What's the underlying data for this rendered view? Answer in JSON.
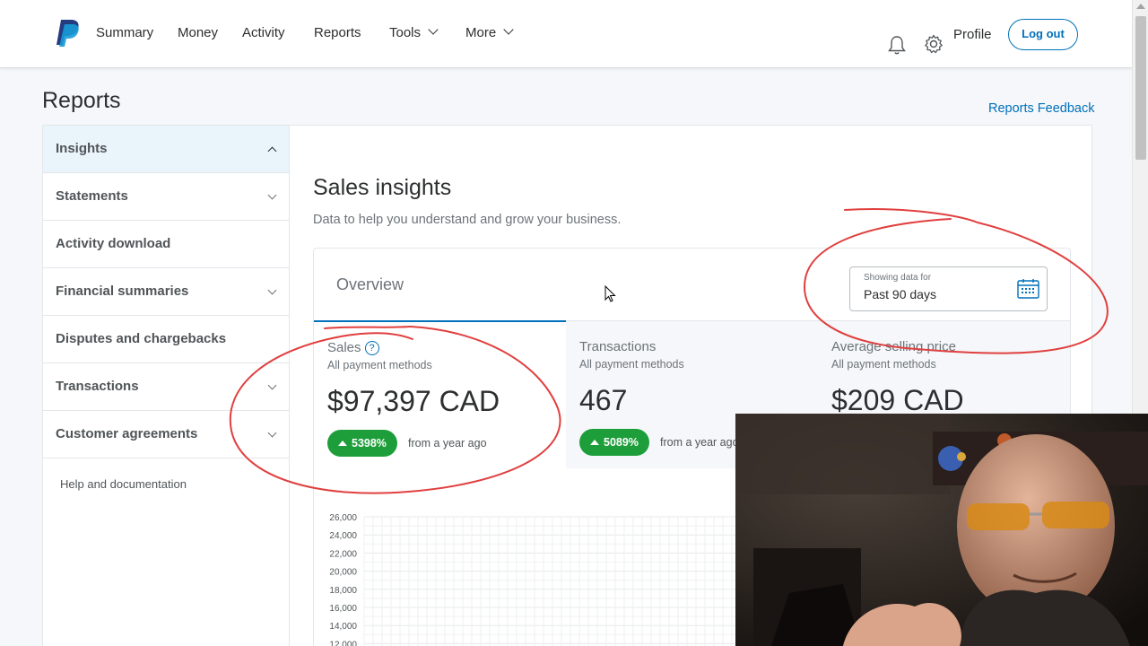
{
  "nav": {
    "items": [
      "Summary",
      "Money",
      "Activity",
      "Reports",
      "Tools",
      "More"
    ],
    "profile": "Profile",
    "logout": "Log out"
  },
  "page": {
    "title": "Reports",
    "feedback": "Reports Feedback"
  },
  "sidebar": {
    "items": [
      {
        "label": "Insights"
      },
      {
        "label": "Statements"
      },
      {
        "label": "Activity download"
      },
      {
        "label": "Financial summaries"
      },
      {
        "label": "Disputes and chargebacks"
      },
      {
        "label": "Transactions"
      },
      {
        "label": "Customer agreements"
      }
    ],
    "help": "Help and documentation"
  },
  "insights": {
    "title": "Sales insights",
    "subtitle": "Data to help you understand and grow your business.",
    "overview": "Overview",
    "date_label": "Showing data for",
    "date_value": "Past 90 days"
  },
  "metrics": [
    {
      "title": "Sales",
      "sub": "All payment methods",
      "value": "$97,397 CAD",
      "badge": "5398%",
      "note": "from a year ago"
    },
    {
      "title": "Transactions",
      "sub": "All payment methods",
      "value": "467",
      "badge": "5089%",
      "note": "from a year ago"
    },
    {
      "title": "Average selling price",
      "sub": "All payment methods",
      "value": "$209 CAD"
    }
  ],
  "chart_ticks": [
    "26,000",
    "24,000",
    "22,000",
    "20,000",
    "18,000",
    "16,000",
    "14,000",
    "12,000"
  ],
  "colors": {
    "accent": "#0070ba",
    "positive": "#1e9e3a",
    "annotation": "#e0403f"
  }
}
